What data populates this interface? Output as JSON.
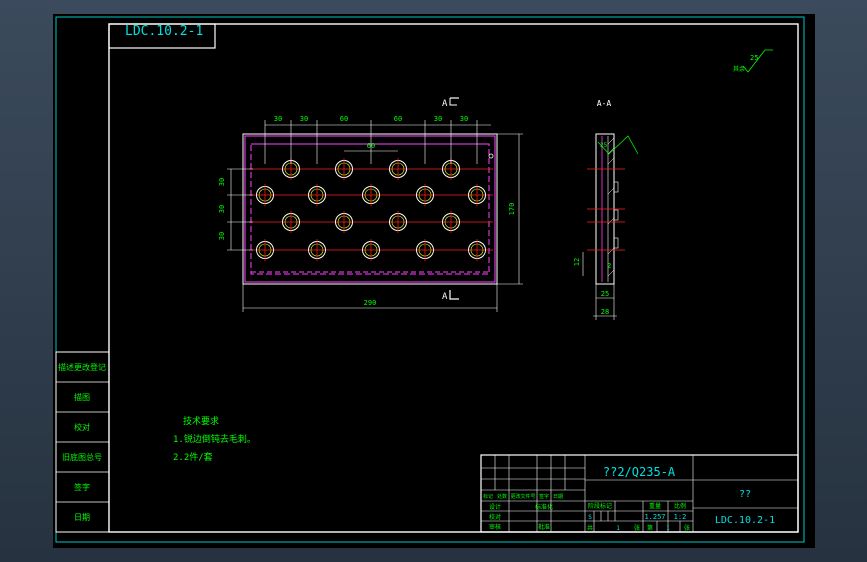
{
  "colors": {
    "frame": "#00c8c8",
    "cyan": "#00e0e0",
    "green": "#00ff00",
    "red": "#ff2020",
    "magenta": "#ff40ff",
    "white": "#ffffff",
    "yellow": "#ffff00",
    "background": "#000000"
  },
  "drawing": {
    "code_box": "LDC.10.2-1",
    "roughness_symbol": "25",
    "roughness_label": "其余"
  },
  "front_view": {
    "dims_top": [
      "30",
      "30",
      "60",
      "60",
      "30",
      "30"
    ],
    "dim_mid": "60",
    "dims_left": [
      "30",
      "30",
      "30"
    ],
    "dim_right": "170",
    "dim_bottom": "290",
    "section_mark_top": "A",
    "section_mark_bottom": "A",
    "holes": {
      "rows": 4,
      "cols_alternating": [
        5,
        4
      ]
    }
  },
  "section_view": {
    "title": "A-A",
    "dim_12": "12",
    "dim_2": "2",
    "dim_25": "25",
    "dim_28": "28"
  },
  "tech_notes": {
    "title": "技术要求",
    "line1": "1.锐边倒钝去毛刺。",
    "line2": "2.2件/套"
  },
  "side_table": {
    "rows": [
      "描述更改登记",
      "描图",
      "校对",
      "旧底图总号",
      "签字",
      "日期"
    ]
  },
  "title_block": {
    "material": "??2/Q235-A",
    "name": "??",
    "code": "LDC.10.2-1",
    "weight": "1.257",
    "scale": "1:2",
    "sheet_label_1": "共",
    "sheet_count": "1",
    "sheet_label_2": "张",
    "sheet_label_3": "第",
    "sheet_no": "1",
    "sheet_label_4": "张",
    "stage_s": "S",
    "header_labels": [
      "标记",
      "处数",
      "更改文件号",
      "签字",
      "日期"
    ],
    "role_labels": [
      "设计",
      "校对",
      "审核",
      "工艺"
    ],
    "std_label": "标准化",
    "approve_label": "批准",
    "stage_label": "阶段标记",
    "weight_label": "重量",
    "scale_label": "比例"
  }
}
